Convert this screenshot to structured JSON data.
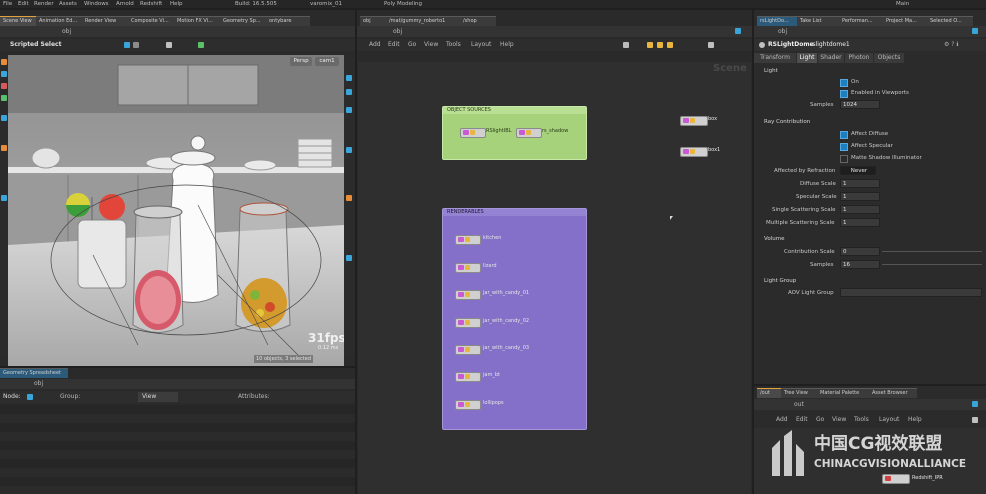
{
  "menu": [
    "File",
    "Edit",
    "Render",
    "Assets",
    "Windows",
    "Arnold",
    "Redshift",
    "Help"
  ],
  "menu_extra": {
    "build": "Build: 16.5.505",
    "title": "varomix_01",
    "desktop": "Poly Modeling",
    "user": "Main"
  },
  "left_tabs": [
    "Scene View",
    "Animation Ed...",
    "Render View",
    "Composite Vi...",
    "Motion FX Vi...",
    "Geometry Sp...",
    "ontybare"
  ],
  "viewport": {
    "path": "obj",
    "tool": "Scripted Select",
    "persp": "Persp",
    "cam": "cam1",
    "fps": "31fps",
    "fps_sub": "0.12 ms",
    "status": "10 objects, 3 selected"
  },
  "spreadsheet": {
    "tab": "Geometry Spreadsheet",
    "path": "obj",
    "node_label": "Node:",
    "group_label": "Group:",
    "view_label": "View",
    "attributes_label": "Attributes:"
  },
  "network": {
    "tabs": [
      "obj",
      "/mat/gummy_roberto1",
      "/shop"
    ],
    "path": "obj",
    "menu": [
      "Add",
      "Edit",
      "Go",
      "View",
      "Tools",
      "Layout",
      "Help"
    ],
    "context_label": "Scene",
    "object_sources_title": "OBJECT SOURCES",
    "object_sources_nodes": [
      "RSlightIBL",
      "rs_shadow"
    ],
    "renderables_title": "RENDERABLES",
    "renderables_nodes": [
      "kitchen",
      "lizard",
      "jar_with_candy_01",
      "jar_with_candy_02",
      "jar_with_candy_03",
      "jam_bt",
      "lollipops"
    ],
    "free_nodes": [
      "box",
      "box1"
    ]
  },
  "parm": {
    "tabs": [
      "rsLightDo...",
      "Take List",
      "Performan...",
      "Project Ma...",
      "Selected O..."
    ],
    "node_type": "RSLightDome",
    "node_name": "rslightdome1",
    "subtabs": [
      "Transform",
      "Light",
      "Shader",
      "Photon",
      "Objects"
    ],
    "active_subtab": "Light",
    "light_label": "Light",
    "on_label": "On",
    "enabled_viewports_label": "Enabled in Viewports",
    "samples_label": "Samples",
    "samples_value": "1024",
    "ray_contribution_label": "Ray Contribution",
    "affect_diffuse_label": "Affect Diffuse",
    "affect_specular_label": "Affect Specular",
    "matte_shadow_label": "Matte Shadow Illuminator",
    "affected_by_refraction_label": "Affected by Refraction",
    "affected_by_refraction_value": "Never",
    "diffuse_scale_label": "Diffuse Scale",
    "diffuse_scale_value": "1",
    "specular_scale_label": "Specular Scale",
    "specular_scale_value": "1",
    "single_scattering_label": "Single Scattering Scale",
    "single_scattering_value": "1",
    "multiple_scattering_label": "Multiple Scattering Scale",
    "multiple_scattering_value": "1",
    "volume_label": "Volume",
    "contribution_scale_label": "Contribution Scale",
    "contribution_scale_value": "0",
    "vol_samples_label": "Samples",
    "vol_samples_value": "16",
    "light_group_label": "Light Group",
    "aov_light_group_label": "AOV Light Group"
  },
  "bottom_right": {
    "tabs": [
      "/out",
      "Tree View",
      "Material Palette",
      "Asset Browser"
    ],
    "path": "out",
    "menu": [
      "Add",
      "Edit",
      "Go",
      "View",
      "Tools",
      "Layout",
      "Help"
    ],
    "node": "Redshift_IPR"
  },
  "watermark": {
    "cn": "中国CG视效联盟",
    "en": "CHINACGVISIONALLIANCE"
  },
  "colors": {
    "accent": "#e4a23c",
    "object_sources": "#a5d27a",
    "renderables": "#8470c8",
    "check": "#1b7fc0"
  }
}
